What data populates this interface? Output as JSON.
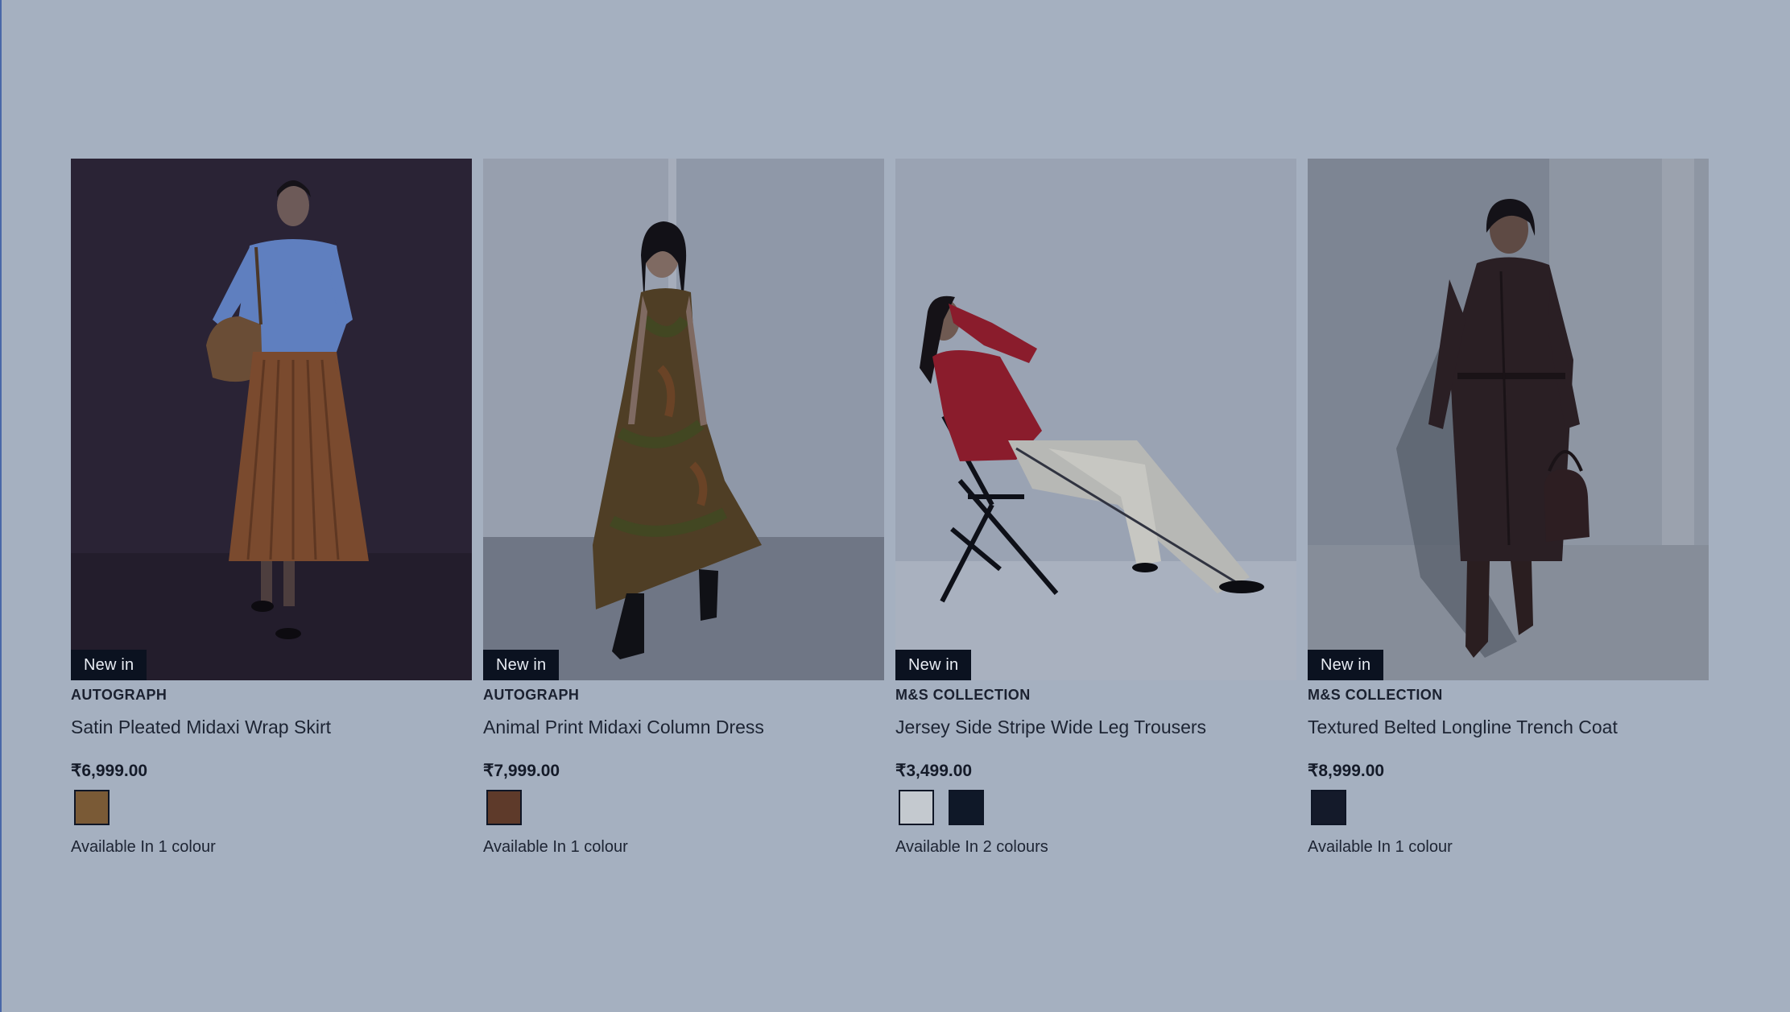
{
  "products": [
    {
      "badge": "New in",
      "brand": "AUTOGRAPH",
      "name": "Satin Pleated Midaxi Wrap Skirt",
      "price": "₹6,999.00",
      "swatches": [
        "#7a5a36"
      ],
      "availability": "Available In 1 colour"
    },
    {
      "badge": "New in",
      "brand": "AUTOGRAPH",
      "name": "Animal Print Midaxi Column Dress",
      "price": "₹7,999.00",
      "swatches": [
        "#5e3a2a"
      ],
      "availability": "Available In 1 colour"
    },
    {
      "badge": "New in",
      "brand": "M&S COLLECTION",
      "name": "Jersey Side Stripe Wide Leg Trousers",
      "price": "₹3,499.00",
      "swatches": [
        "#c4c9cf",
        "#0f1828"
      ],
      "availability": "Available In 2 colours"
    },
    {
      "badge": "New in",
      "brand": "M&S COLLECTION",
      "name": "Textured Belted Longline Trench Coat",
      "price": "₹8,999.00",
      "swatches": [
        "#141a2a"
      ],
      "availability": "Available In 1 colour"
    }
  ]
}
